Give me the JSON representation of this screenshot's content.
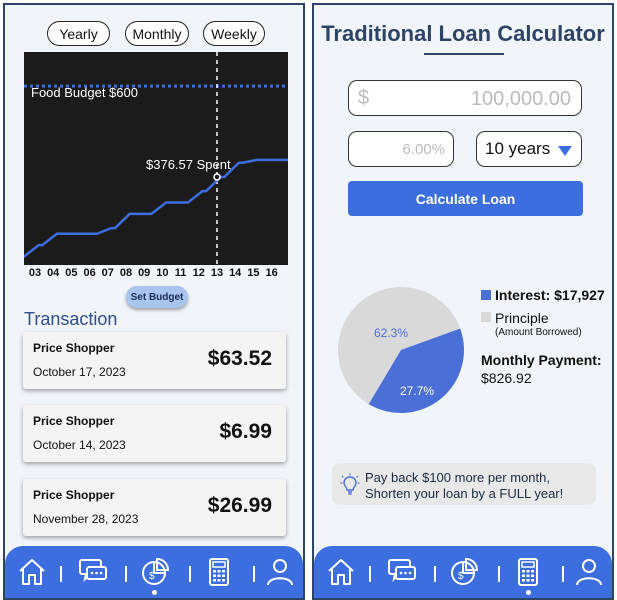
{
  "budget_screen": {
    "range_tabs": [
      "Yearly",
      "Monthly",
      "Weekly"
    ],
    "set_budget_label": "Set Budget",
    "transaction_heading": "Transaction",
    "transactions": [
      {
        "merchant": "Price Shopper",
        "date": "October 17, 2023",
        "amount": "$63.52"
      },
      {
        "merchant": "Price Shopper",
        "date": "October 14, 2023",
        "amount": "$6.99"
      },
      {
        "merchant": "Price Shopper",
        "date": "November 28, 2023",
        "amount": "$26.99"
      }
    ]
  },
  "chart_data": {
    "type": "line",
    "budget_label": "Food Budget $600",
    "spent_label": "$376.57 Spent",
    "budget_value": 600,
    "spent_value": 376.57,
    "current_day": "13",
    "x": [
      "03",
      "04",
      "05",
      "06",
      "07",
      "08",
      "09",
      "10",
      "11",
      "12",
      "13",
      "14",
      "15",
      "16"
    ],
    "series": [
      {
        "values": [
          0,
          40,
          80,
          80,
          80,
          100,
          150,
          150,
          190,
          190,
          230,
          280,
          330,
          340,
          340
        ]
      }
    ],
    "ylim": [
      -30,
      720
    ],
    "colors": {
      "line": "#3c6ee0",
      "budget_line": "#3c6ee0",
      "background": "#1b1b1b",
      "marker": "#ffffff"
    }
  },
  "loan_screen": {
    "title": "Traditional Loan Calculator",
    "amount_prefix": "$",
    "amount_value": "100,000.00",
    "rate_value": "6.00%",
    "term_value": "10 years",
    "calculate_label": "Calculate Loan",
    "pie": {
      "slices": [
        {
          "label": "62.3%",
          "value": 62.3,
          "color": "#d9d9d9"
        },
        {
          "label": "27.7%",
          "value": 27.7,
          "color": "#4a6fd6"
        }
      ]
    },
    "legend": {
      "interest_label": "Interest: $17,927",
      "interest_color": "#4a6fd6",
      "principle_label": "Principle",
      "principle_sub": "(Amount Borrowed)",
      "principle_color": "#d9d9d9"
    },
    "monthly_label": "Monthly Payment:",
    "monthly_value": "$826.92",
    "tip_line1": "Pay back $100 more per month,",
    "tip_line2": "Shorten your loan by a FULL year!"
  },
  "nav": {
    "items": [
      "home-icon",
      "chat-icon",
      "budget-pie-icon",
      "calculator-icon",
      "profile-icon"
    ],
    "left_active": "budget-pie-icon",
    "right_active": "calculator-icon",
    "color": "#3c6ee0"
  }
}
